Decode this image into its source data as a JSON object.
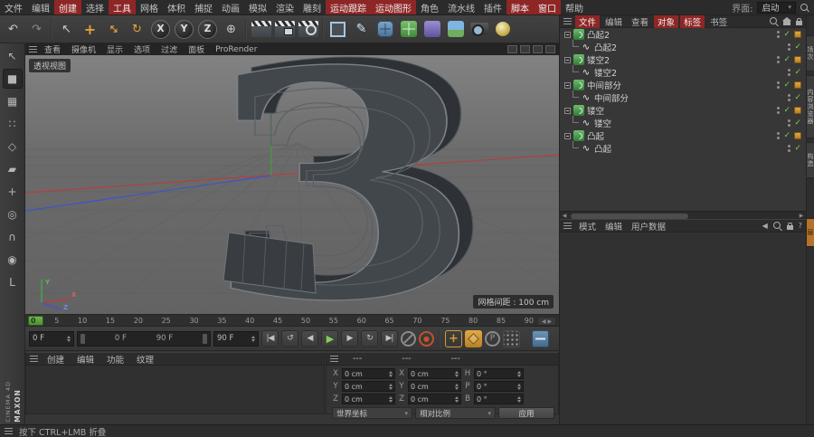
{
  "menubar": {
    "items": [
      {
        "label": "文件"
      },
      {
        "label": "编辑"
      },
      {
        "label": "创建"
      },
      {
        "label": "选择"
      },
      {
        "label": "工具"
      },
      {
        "label": "网格"
      },
      {
        "label": "体积"
      },
      {
        "label": "捕捉"
      },
      {
        "label": "动画"
      },
      {
        "label": "模拟"
      },
      {
        "label": "渲染"
      },
      {
        "label": "雕刻"
      },
      {
        "label": "运动跟踪"
      },
      {
        "label": "运动图形"
      },
      {
        "label": "角色"
      },
      {
        "label": "流水线"
      },
      {
        "label": "插件"
      },
      {
        "label": "脚本"
      },
      {
        "label": "窗口"
      },
      {
        "label": "帮助"
      }
    ],
    "interface_label": "界面:",
    "interface_value": "启动"
  },
  "toolbar": {
    "undo": "↶",
    "redo": "↷",
    "select": "↖",
    "move": "+",
    "scale": "↔",
    "rotate": "↻",
    "axis_x": "X",
    "axis_y": "Y",
    "axis_z": "Z",
    "coord": "⊕",
    "pen": "✎"
  },
  "left_toolbar": {
    "icons": [
      {
        "name": "make-editable",
        "glyph": "↖"
      },
      {
        "name": "model-mode",
        "glyph": "■"
      },
      {
        "name": "texture-mode",
        "glyph": "▦"
      },
      {
        "name": "points-mode",
        "glyph": "∷"
      },
      {
        "name": "edges-mode",
        "glyph": "◇"
      },
      {
        "name": "polygons-mode",
        "glyph": "▰"
      },
      {
        "name": "enable-axis",
        "glyph": "+"
      },
      {
        "name": "viewport-solo",
        "glyph": "◎"
      },
      {
        "name": "enable-snap",
        "glyph": "∩"
      },
      {
        "name": "quantize",
        "glyph": "◉"
      },
      {
        "name": "workplane-lock",
        "glyph": "L"
      }
    ]
  },
  "viewport": {
    "menu": [
      "查看",
      "摄像机",
      "显示",
      "选项",
      "过滤",
      "面板",
      "ProRender"
    ],
    "view_label": "透视视图",
    "grid_label": "网格间距 : 100 cm",
    "model_glyph": "3",
    "axis": {
      "x": "X",
      "y": "Y",
      "z": "Z"
    }
  },
  "timeline": {
    "ticks": [
      "0",
      "5",
      "10",
      "15",
      "20",
      "25",
      "30",
      "35",
      "40",
      "45",
      "50",
      "55",
      "60",
      "65",
      "70",
      "75",
      "80",
      "85",
      "90"
    ]
  },
  "transport": {
    "current": "0 F",
    "range_start": "0 F",
    "range_end": "90 F",
    "end": "90 F",
    "buttons": [
      {
        "name": "goto-start",
        "glyph": "|◀"
      },
      {
        "name": "play-backwards",
        "glyph": "↺"
      },
      {
        "name": "previous-frame",
        "glyph": "◀"
      },
      {
        "name": "play",
        "glyph": "▶"
      },
      {
        "name": "next-frame",
        "glyph": "▶"
      },
      {
        "name": "play-mode",
        "glyph": "↻"
      },
      {
        "name": "goto-end",
        "glyph": "▶|"
      }
    ],
    "record_glyph": "●",
    "p_label": "P"
  },
  "material_manager": {
    "tabs": [
      "创建",
      "编辑",
      "功能",
      "纹理"
    ]
  },
  "coordinates": {
    "headers": [
      "---",
      "---",
      "---"
    ],
    "position": {
      "labels": [
        "X",
        "Y",
        "Z"
      ],
      "x": "0 cm",
      "y": "0 cm",
      "z": "0 cm"
    },
    "size": {
      "labels": [
        "X",
        "Y",
        "Z"
      ],
      "x": "0 cm",
      "y": "0 cm",
      "z": "0 cm"
    },
    "rotation": {
      "labels": [
        "H",
        "P",
        "B"
      ],
      "h": "0 °",
      "p": "0 °",
      "b": "0 °"
    },
    "coord_system": "世界坐标",
    "scale_mode": "相对比例",
    "apply_label": "应用"
  },
  "object_manager": {
    "menu": [
      "文件",
      "编辑",
      "查看",
      "对象",
      "标签",
      "书签"
    ],
    "check_glyph": "✓",
    "spline_glyph": "∿",
    "rows": [
      {
        "name": "凸起2",
        "kind": "generator"
      },
      {
        "name": "凸起2",
        "kind": "spline"
      },
      {
        "name": "镂空2",
        "kind": "generator"
      },
      {
        "name": "镂空2",
        "kind": "spline"
      },
      {
        "name": "中间部分",
        "kind": "generator"
      },
      {
        "name": "中间部分",
        "kind": "spline"
      },
      {
        "name": "镂空",
        "kind": "generator"
      },
      {
        "name": "镂空",
        "kind": "spline"
      },
      {
        "name": "凸起",
        "kind": "generator"
      },
      {
        "name": "凸起",
        "kind": "spline"
      }
    ]
  },
  "attribute_manager": {
    "menu": [
      "模式",
      "编辑",
      "用户数据"
    ],
    "back_glyph": "◀",
    "help_glyph": "?"
  },
  "side_tabs": [
    "场次",
    "内容浏览器",
    "构造",
    "层"
  ],
  "status_bar": {
    "hint": "按下 CTRL+LMB 折叠"
  },
  "branding": {
    "maxon": "MAXON",
    "cinema": "CINEMA 4D"
  }
}
